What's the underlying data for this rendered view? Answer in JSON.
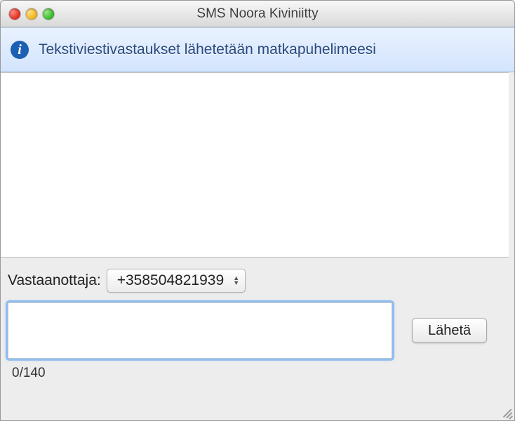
{
  "window": {
    "title": "SMS Noora Kiviniitty"
  },
  "info": {
    "message": "Tekstiviestivastaukset lähetetään matkapuhelimeesi"
  },
  "recipient": {
    "label": "Vastaanottaja:",
    "selected": "+358504821939"
  },
  "compose": {
    "value": "",
    "send_label": "Lähetä",
    "counter": "0/140"
  }
}
